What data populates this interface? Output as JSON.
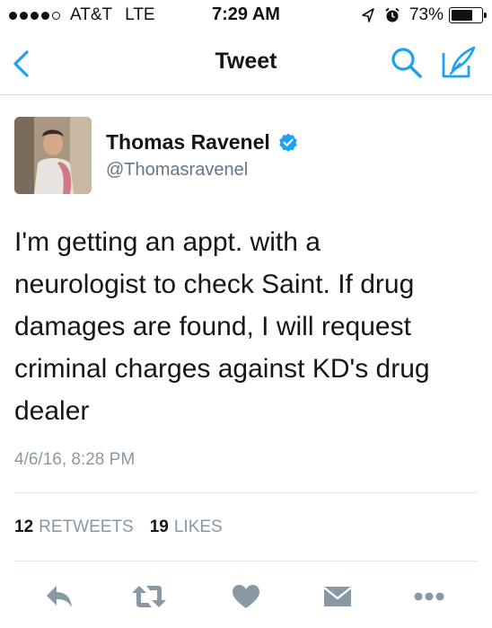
{
  "status_bar": {
    "carrier": "AT&T",
    "network": "LTE",
    "time": "7:29 AM",
    "battery_text": "73%",
    "battery_level": 0.73,
    "signal_bars_filled": 4,
    "signal_bars_total": 5
  },
  "nav": {
    "title": "Tweet"
  },
  "tweet": {
    "author_name": "Thomas Ravenel",
    "author_handle": "@Thomasravenel",
    "text_lines": [
      "I'm getting an appt. with a",
      "neurologist to check Saint. If drug",
      "damages are found, I will request",
      "criminal charges against KD's drug",
      "dealer"
    ],
    "timestamp": "4/6/16, 8:28 PM",
    "retweets_count": "12",
    "retweets_label": "RETWEETS",
    "likes_count": "19",
    "likes_label": "LIKES"
  },
  "colors": {
    "twitter_blue": "#1da1f2",
    "icon_gray": "#8899a6",
    "verified_blue": "#1da1f2"
  }
}
